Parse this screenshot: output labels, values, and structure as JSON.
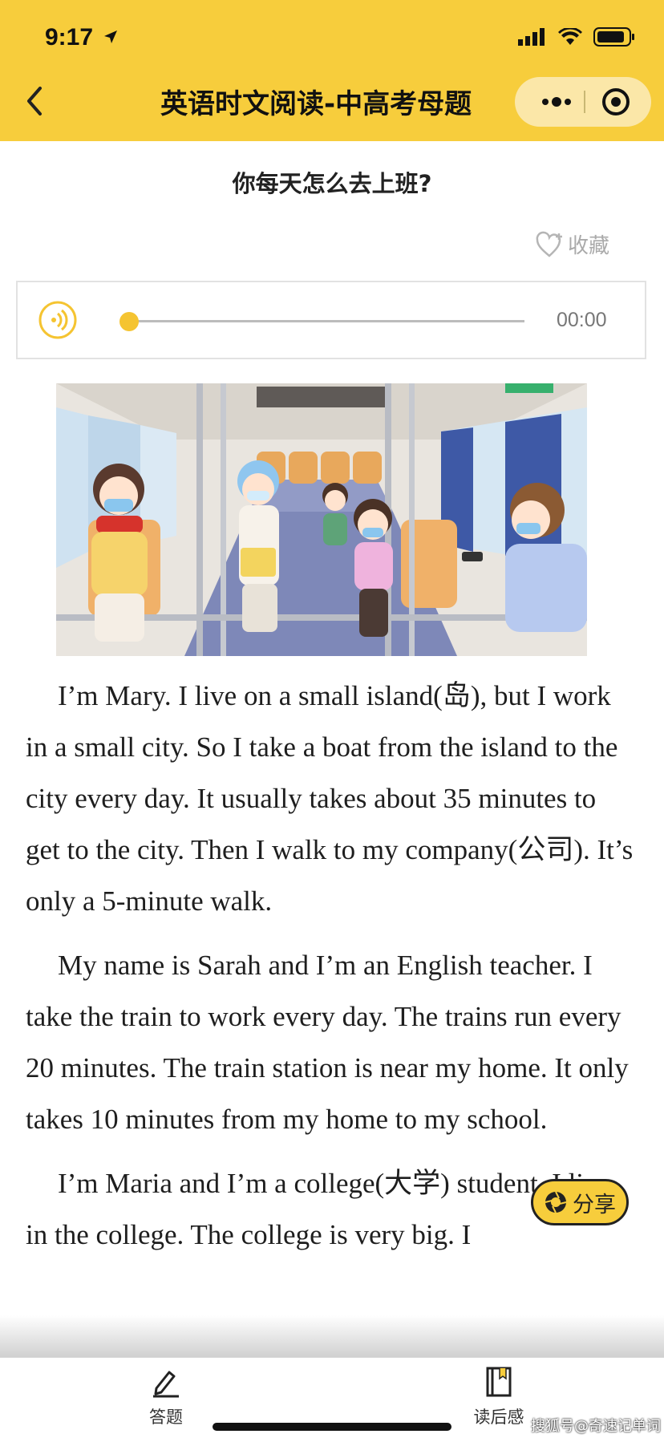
{
  "status_bar": {
    "time": "9:17"
  },
  "nav": {
    "title": "英语时文阅读-中高考母题"
  },
  "article": {
    "title": "你每天怎么去上班?",
    "favorite_label": "收藏",
    "paragraphs": [
      "I’m Mary. I live on a small island(岛), but I work in a small city. So I take a boat from the island to the city every day. It usually takes about 35 minutes to get to the city. Then I walk to my company(公司). It’s only a 5-minute walk.",
      "My name is Sarah and I’m an English teacher. I take the train to work every day. The trains run every 20 minutes. The train station is near my home. It only takes 10 minutes from my home to my school.",
      "I’m Maria and I’m a college(大学) student. I live in the college. The college is very big. I"
    ]
  },
  "audio": {
    "time": "00:00",
    "progress": 0
  },
  "share_label": "分享",
  "tabbar": {
    "answer_label": "答题",
    "reflection_label": "读后感"
  },
  "watermark": "搜狐号@奇速记单词",
  "colors": {
    "accent": "#f7cd3c",
    "knob": "#f5c431"
  }
}
